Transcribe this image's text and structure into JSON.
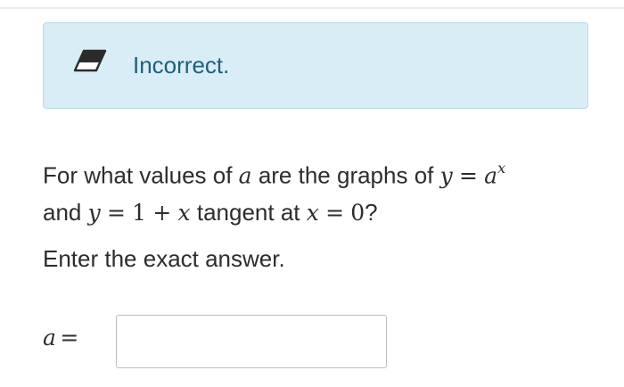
{
  "feedback": {
    "message": "Incorrect.",
    "icon": "eraser-icon",
    "background_color": "#d9edf7",
    "text_color": "#1f5f7a"
  },
  "question": {
    "q1": "For what values of",
    "var_a": "a",
    "q2": "are the graphs of",
    "y1": "y",
    "eq1": "=",
    "base": "a",
    "exponent": "x",
    "q3": "and",
    "y2": "y",
    "eq2": "=",
    "one": "1",
    "plus": "+",
    "x1": "x",
    "q4": "tangent at",
    "x2": "x",
    "eq3": "=",
    "zero": "0",
    "qmark": "?"
  },
  "instruction": "Enter the exact answer.",
  "answer": {
    "label_var": "a",
    "label_eq": "=",
    "value": ""
  }
}
